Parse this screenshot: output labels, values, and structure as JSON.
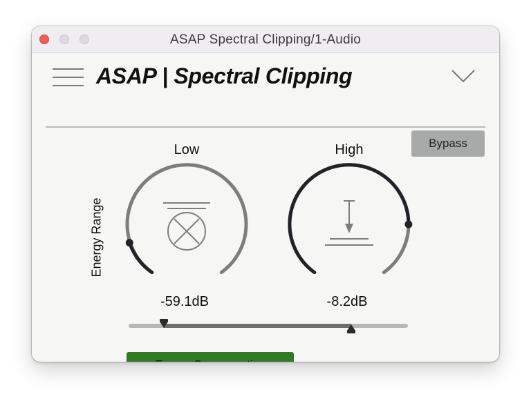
{
  "window": {
    "title": "ASAP Spectral Clipping/1-Audio"
  },
  "header": {
    "title": "ASAP | Spectral Clipping",
    "menu_icon": "hamburger-menu-icon",
    "dropdown_icon": "chevron-down-icon"
  },
  "bypass_button": {
    "label": "Bypass"
  },
  "energy_range": {
    "label": "Energy Range",
    "low": {
      "label": "Low",
      "value_text": "-59.1dB",
      "icon": "floor-clip-icon"
    },
    "high": {
      "label": "High",
      "value_text": "-8.2dB",
      "icon": "ceiling-limit-icon"
    }
  },
  "energy_compensation_button": {
    "label": "Energy Compensation"
  },
  "colors": {
    "accent_green": "#327b25",
    "knob_active": "#222227",
    "knob_track": "#7d7d7d",
    "window_bg": "#f6f6f4"
  }
}
